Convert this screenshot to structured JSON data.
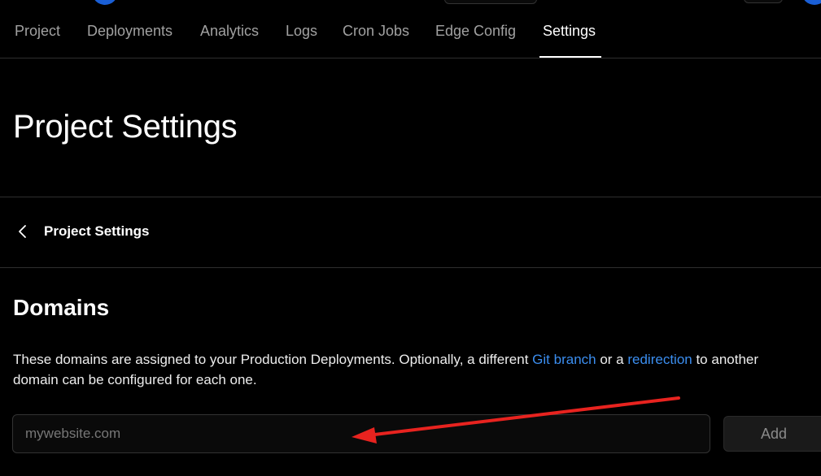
{
  "nav": {
    "tabs": [
      {
        "label": "Project"
      },
      {
        "label": "Deployments"
      },
      {
        "label": "Analytics"
      },
      {
        "label": "Logs"
      },
      {
        "label": "Cron Jobs"
      },
      {
        "label": "Edge Config"
      },
      {
        "label": "Settings",
        "active": true
      }
    ]
  },
  "header": {
    "title": "Project Settings"
  },
  "breadcrumb": {
    "back_icon": "chevron-left-icon",
    "label": "Project Settings"
  },
  "domains": {
    "heading": "Domains",
    "description": {
      "part1": "These domains are assigned to your Production Deployments. Optionally, a different ",
      "link1": "Git branch",
      "part2": " or a ",
      "link2": "redirection",
      "part3": " to another domain can be configured for each one."
    },
    "input": {
      "placeholder": "mywebsite.com",
      "value": ""
    },
    "add_button": "Add"
  },
  "colors": {
    "background": "#000000",
    "link": "#3b8ef0",
    "annotation_arrow": "#e8231f"
  }
}
